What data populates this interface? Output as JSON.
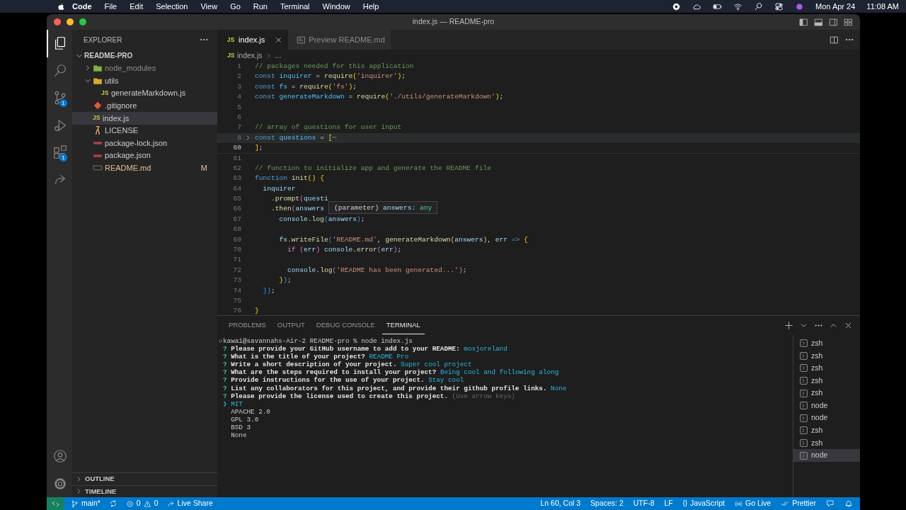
{
  "menubar": {
    "app": "Code",
    "menus": [
      "File",
      "Edit",
      "Selection",
      "View",
      "Go",
      "Run",
      "Terminal",
      "Window",
      "Help"
    ],
    "date": "Mon Apr 24",
    "time": "11:08 AM"
  },
  "window": {
    "title": "index.js — README-pro"
  },
  "activity_bar": {
    "items": [
      {
        "kind": "files",
        "selected": true
      },
      {
        "kind": "search",
        "selected": false
      },
      {
        "kind": "source-control",
        "selected": false,
        "badge": "1"
      },
      {
        "kind": "run",
        "selected": false
      },
      {
        "kind": "extensions",
        "selected": false,
        "badge": "1"
      },
      {
        "kind": "live-share",
        "selected": false
      }
    ],
    "bottom": [
      {
        "kind": "account"
      },
      {
        "kind": "settings"
      }
    ]
  },
  "sidebar": {
    "title": "EXPLORER",
    "root": {
      "name": "README-PRO",
      "expanded": true,
      "children": [
        {
          "name": "node_modules",
          "kind": "node-folder",
          "expanded": false,
          "dimmed": true
        },
        {
          "name": "utils",
          "kind": "folder",
          "expanded": true,
          "children": [
            {
              "name": "generateMarkdown.js",
              "kind": "js",
              "icon_label": "JS",
              "selected": false
            }
          ]
        },
        {
          "name": ".gitignore",
          "kind": "git",
          "selected": false
        },
        {
          "name": "index.js",
          "kind": "js",
          "icon_label": "JS",
          "selected": true
        },
        {
          "name": "LICENSE",
          "kind": "license",
          "selected": false
        },
        {
          "name": "package-lock.json",
          "kind": "json",
          "selected": false
        },
        {
          "name": "package.json",
          "kind": "json",
          "selected": false
        },
        {
          "name": "README.md",
          "kind": "markdown",
          "selected": false,
          "modified": true,
          "badge": "M"
        }
      ]
    },
    "sections": [
      {
        "title": "OUTLINE",
        "expanded": false
      },
      {
        "title": "TIMELINE",
        "expanded": false
      }
    ]
  },
  "editor": {
    "tabs": [
      {
        "label": "index.js",
        "kind": "js",
        "icon_label": "JS",
        "selected": true
      },
      {
        "label": "Preview README.md",
        "kind": "preview",
        "selected": false
      }
    ],
    "breadcrumb": [
      {
        "text": "index.js",
        "icon_label": "JS"
      },
      {
        "text": "..."
      }
    ],
    "lines": [
      {
        "number": "1",
        "tokens": [
          {
            "text": "// packages needed for this application",
            "kind": "comment"
          }
        ]
      },
      {
        "number": "2",
        "tokens": [
          {
            "text": "const ",
            "kind": "keyword"
          },
          {
            "text": "inquirer",
            "kind": "constant"
          },
          {
            "text": " = ",
            "kind": "plain"
          },
          {
            "text": "require",
            "kind": "function"
          },
          {
            "text": "(",
            "kind": "bracket1"
          },
          {
            "text": "'inquirer'",
            "kind": "string"
          },
          {
            "text": ")",
            "kind": "bracket1"
          },
          {
            "text": ";",
            "kind": "plain"
          }
        ]
      },
      {
        "number": "3",
        "tokens": [
          {
            "text": "const ",
            "kind": "keyword"
          },
          {
            "text": "fs",
            "kind": "constant"
          },
          {
            "text": " = ",
            "kind": "plain"
          },
          {
            "text": "require",
            "kind": "function"
          },
          {
            "text": "(",
            "kind": "bracket1"
          },
          {
            "text": "'fs'",
            "kind": "string"
          },
          {
            "text": ")",
            "kind": "bracket1"
          },
          {
            "text": ";",
            "kind": "plain"
          }
        ]
      },
      {
        "number": "4",
        "tokens": [
          {
            "text": "const ",
            "kind": "keyword"
          },
          {
            "text": "generateMarkdown",
            "kind": "constant"
          },
          {
            "text": " = ",
            "kind": "plain"
          },
          {
            "text": "require",
            "kind": "function"
          },
          {
            "text": "(",
            "kind": "bracket1"
          },
          {
            "text": "'./utils/generateMarkdown'",
            "kind": "string"
          },
          {
            "text": ")",
            "kind": "bracket1"
          },
          {
            "text": ";",
            "kind": "plain"
          }
        ]
      },
      {
        "number": "5"
      },
      {
        "number": "6"
      },
      {
        "number": "7",
        "tokens": [
          {
            "text": "// array of questions for user input",
            "kind": "comment"
          }
        ]
      },
      {
        "number": "8",
        "folded": true,
        "tokens": [
          {
            "text": "const ",
            "kind": "keyword"
          },
          {
            "text": "questions",
            "kind": "constant"
          },
          {
            "text": " = ",
            "kind": "plain"
          },
          {
            "text": "[",
            "kind": "bracket1"
          },
          {
            "text": "⋯",
            "kind": "fold"
          }
        ]
      },
      {
        "number": "60",
        "current": true,
        "tokens": [
          {
            "text": "]",
            "kind": "bracket1"
          },
          {
            "text": ";",
            "kind": "plain"
          }
        ]
      },
      {
        "number": "61"
      },
      {
        "number": "62",
        "tokens": [
          {
            "text": "// function to initialize app and generate the README file",
            "kind": "comment"
          }
        ]
      },
      {
        "number": "63",
        "tokens": [
          {
            "text": "function ",
            "kind": "keyword"
          },
          {
            "text": "init",
            "kind": "function"
          },
          {
            "text": "() {",
            "kind": "bracket1"
          }
        ]
      },
      {
        "number": "64",
        "tokens": [
          {
            "text": "  inquirer",
            "kind": "variable"
          }
        ]
      },
      {
        "number": "65",
        "tokens": [
          {
            "text": "    .",
            "kind": "plain"
          },
          {
            "text": "prompt",
            "kind": "function"
          },
          {
            "text": "(",
            "kind": "bracket2"
          },
          {
            "text": "questi",
            "kind": "variable"
          }
        ]
      },
      {
        "number": "66",
        "tokens": [
          {
            "text": "    .",
            "kind": "plain"
          },
          {
            "text": "then",
            "kind": "function"
          },
          {
            "text": "(",
            "kind": "bracket2"
          },
          {
            "text": "answers",
            "kind": "variable"
          }
        ]
      },
      {
        "number": "67",
        "tokens": [
          {
            "text": "      console",
            "kind": "variable"
          },
          {
            "text": ".",
            "kind": "plain"
          },
          {
            "text": "log",
            "kind": "function"
          },
          {
            "text": "(",
            "kind": "bracket3"
          },
          {
            "text": "answers",
            "kind": "variable"
          },
          {
            "text": ")",
            "kind": "bracket3"
          },
          {
            "text": ";",
            "kind": "plain"
          }
        ]
      },
      {
        "number": "68"
      },
      {
        "number": "69",
        "tokens": [
          {
            "text": "      fs",
            "kind": "variable"
          },
          {
            "text": ".",
            "kind": "plain"
          },
          {
            "text": "writeFile",
            "kind": "function"
          },
          {
            "text": "(",
            "kind": "bracket3"
          },
          {
            "text": "'README.md'",
            "kind": "string"
          },
          {
            "text": ", ",
            "kind": "plain"
          },
          {
            "text": "generateMarkdown",
            "kind": "function"
          },
          {
            "text": "(",
            "kind": "bracket1"
          },
          {
            "text": "answers",
            "kind": "variable"
          },
          {
            "text": ")",
            "kind": "bracket1"
          },
          {
            "text": ", ",
            "kind": "plain"
          },
          {
            "text": "err ",
            "kind": "variable"
          },
          {
            "text": "=> ",
            "kind": "keyword"
          },
          {
            "text": "{",
            "kind": "bracket1"
          }
        ]
      },
      {
        "number": "70",
        "tokens": [
          {
            "text": "        if ",
            "kind": "control"
          },
          {
            "text": "(",
            "kind": "bracket2"
          },
          {
            "text": "err",
            "kind": "variable"
          },
          {
            "text": ") ",
            "kind": "bracket2"
          },
          {
            "text": "console",
            "kind": "variable"
          },
          {
            "text": ".",
            "kind": "plain"
          },
          {
            "text": "error",
            "kind": "function"
          },
          {
            "text": "(",
            "kind": "bracket2"
          },
          {
            "text": "err",
            "kind": "variable"
          },
          {
            "text": ")",
            "kind": "bracket2"
          },
          {
            "text": ";",
            "kind": "plain"
          }
        ]
      },
      {
        "number": "71"
      },
      {
        "number": "72",
        "tokens": [
          {
            "text": "        console",
            "kind": "variable"
          },
          {
            "text": ".",
            "kind": "plain"
          },
          {
            "text": "log",
            "kind": "function"
          },
          {
            "text": "(",
            "kind": "bracket2"
          },
          {
            "text": "'README has been generated...'",
            "kind": "string"
          },
          {
            "text": ")",
            "kind": "bracket2"
          },
          {
            "text": ";",
            "kind": "plain"
          }
        ]
      },
      {
        "number": "73",
        "tokens": [
          {
            "text": "      }",
            "kind": "bracket1"
          },
          {
            "text": ")",
            "kind": "bracket3"
          },
          {
            "text": ";",
            "kind": "plain"
          }
        ]
      },
      {
        "number": "74",
        "tokens": [
          {
            "text": "  })",
            "kind": "bracket3"
          },
          {
            "text": ";",
            "kind": "plain"
          }
        ]
      },
      {
        "number": "75"
      },
      {
        "number": "76",
        "tokens": [
          {
            "text": "}",
            "kind": "bracket1"
          }
        ]
      }
    ],
    "hover": [
      {
        "text": "(parameter) ",
        "kind": "plain"
      },
      {
        "text": "answers",
        "kind": "variable"
      },
      {
        "text": ": ",
        "kind": "plain"
      },
      {
        "text": "any",
        "kind": "type"
      }
    ]
  },
  "panel": {
    "tabs": [
      {
        "label": "PROBLEMS",
        "selected": false
      },
      {
        "label": "OUTPUT",
        "selected": false
      },
      {
        "label": "DEBUG CONSOLE",
        "selected": false
      },
      {
        "label": "TERMINAL",
        "selected": true
      }
    ],
    "terminal_lines": [
      {
        "kind": "command",
        "tokens": [
          {
            "text": "kawai@savannahs-Air-2 README-pro % node index.js",
            "kind": "plain"
          }
        ]
      },
      {
        "tokens": [
          {
            "text": "?",
            "kind": "mark"
          },
          {
            "text": " Please provide your GitHub username to add to your README:",
            "kind": "question"
          },
          {
            "text": " mosjoreland",
            "kind": "answer"
          }
        ]
      },
      {
        "tokens": [
          {
            "text": "?",
            "kind": "mark"
          },
          {
            "text": " What is the title of your project?",
            "kind": "question"
          },
          {
            "text": " README Pro",
            "kind": "answer"
          }
        ]
      },
      {
        "tokens": [
          {
            "text": "?",
            "kind": "mark"
          },
          {
            "text": " Write a short description of your project.",
            "kind": "question"
          },
          {
            "text": " Super cool project",
            "kind": "answer"
          }
        ]
      },
      {
        "tokens": [
          {
            "text": "?",
            "kind": "mark"
          },
          {
            "text": " What are the steps required to install your project?",
            "kind": "question"
          },
          {
            "text": " Being cool and following along",
            "kind": "answer"
          }
        ]
      },
      {
        "tokens": [
          {
            "text": "?",
            "kind": "mark"
          },
          {
            "text": " Provide instructions for the use of your project.",
            "kind": "question"
          },
          {
            "text": " Stay cool",
            "kind": "answer"
          }
        ]
      },
      {
        "tokens": [
          {
            "text": "?",
            "kind": "mark"
          },
          {
            "text": " List any collaborators for this project, and provide their github profile links.",
            "kind": "question"
          },
          {
            "text": " None",
            "kind": "answer"
          }
        ]
      },
      {
        "tokens": [
          {
            "text": "?",
            "kind": "mark"
          },
          {
            "text": " Please provide the license used to create this project.",
            "kind": "question"
          },
          {
            "text": " (Use arrow keys)",
            "kind": "hint"
          }
        ]
      },
      {
        "tokens": [
          {
            "text": "❯ MIT",
            "kind": "answer"
          }
        ]
      },
      {
        "tokens": [
          {
            "text": "  APACHE 2.0",
            "kind": "plain"
          }
        ]
      },
      {
        "tokens": [
          {
            "text": "  GPL 3.0",
            "kind": "plain"
          }
        ]
      },
      {
        "tokens": [
          {
            "text": "  BSD 3",
            "kind": "plain"
          }
        ]
      },
      {
        "tokens": [
          {
            "text": "  None",
            "kind": "plain"
          }
        ]
      }
    ],
    "sessions": [
      {
        "name": "zsh",
        "selected": false
      },
      {
        "name": "zsh",
        "selected": false
      },
      {
        "name": "zsh",
        "selected": false
      },
      {
        "name": "zsh",
        "selected": false
      },
      {
        "name": "zsh",
        "selected": false
      },
      {
        "name": "node",
        "selected": false
      },
      {
        "name": "node",
        "selected": false
      },
      {
        "name": "zsh",
        "selected": false
      },
      {
        "name": "zsh",
        "selected": false
      },
      {
        "name": "node",
        "selected": true
      }
    ]
  },
  "status_bar": {
    "left": [
      {
        "kind": "remote"
      },
      {
        "kind": "branch",
        "text": "main*"
      },
      {
        "kind": "sync"
      },
      {
        "kind": "problems",
        "errors": "0",
        "warnings": "0"
      },
      {
        "kind": "live-share",
        "text": "Live Share"
      }
    ],
    "right": [
      {
        "kind": "plain",
        "text": "Ln 60, Col 3"
      },
      {
        "kind": "plain",
        "text": "Spaces: 2"
      },
      {
        "kind": "plain",
        "text": "UTF-8"
      },
      {
        "kind": "plain",
        "text": "LF"
      },
      {
        "kind": "language",
        "glyph": "{}",
        "text": "JavaScript"
      },
      {
        "kind": "go-live",
        "text": "Go Live"
      },
      {
        "kind": "prettier",
        "text": "Prettier"
      },
      {
        "kind": "feedback"
      },
      {
        "kind": "bell"
      }
    ]
  }
}
